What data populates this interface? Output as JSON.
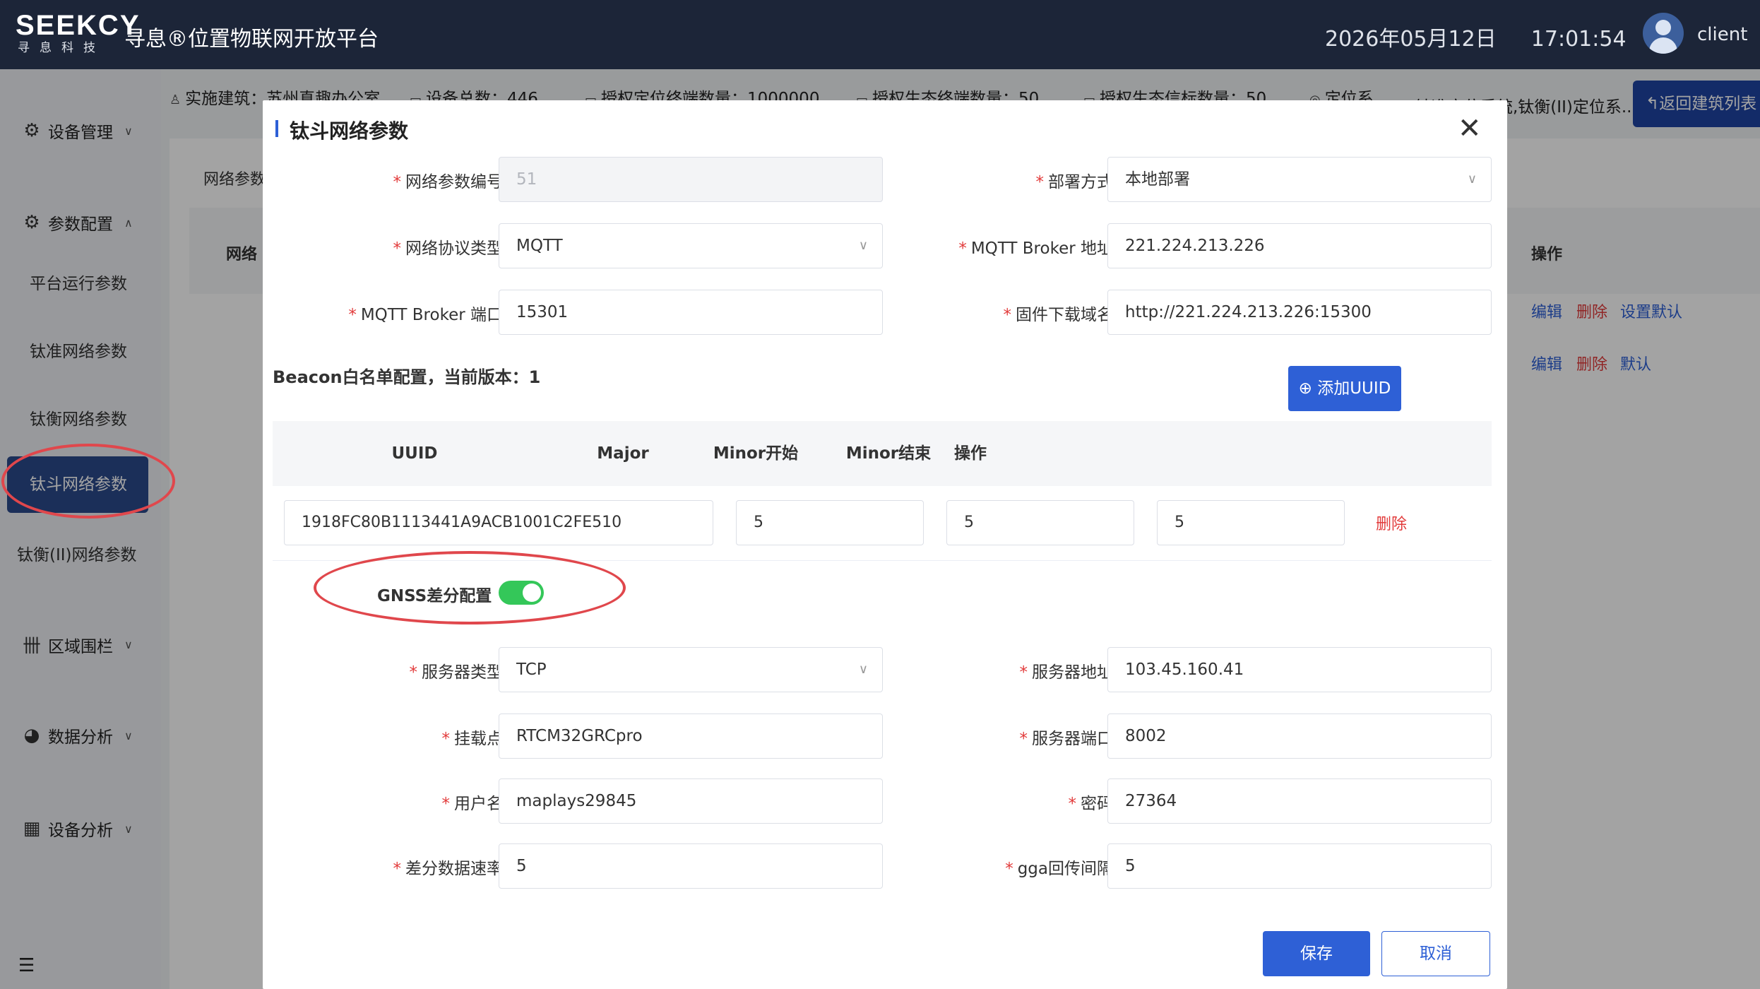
{
  "header": {
    "logo_main": "SEEKCY",
    "logo_sub": "寻息科技",
    "app_title": "寻息®位置物联网开放平台",
    "date": "2026年05月12日",
    "time": "17:01:54",
    "username": "client"
  },
  "sidebar": {
    "device_mgmt": "设备管理",
    "param_config": "参数配置",
    "items": [
      "平台运行参数",
      "钛准网络参数",
      "钛衡网络参数",
      "钛斗网络参数",
      "钛衡(II)网络参数"
    ],
    "area_fence": "区域围栏",
    "data_analysis": "数据分析",
    "device_analysis": "设备分析"
  },
  "infobar": {
    "building": "实施建筑：苏州真趣办公室",
    "device_total": "设备总数：446",
    "auth_terminal": "授权定位终端数量：1000000",
    "auth_eco_terminal": "授权生态终端数量：50",
    "auth_eco_beacon": "授权生态信标数量：50",
    "positioning": "定位系",
    "positioning_more": "钛准定位系统,钛衡(II)定位系...",
    "back_button": "返回建筑列表"
  },
  "background": {
    "filter_label": "网络参数",
    "col_network": "网络",
    "col_ops": "操作",
    "row1": {
      "edit": "编辑",
      "delete": "删除",
      "set_default": "设置默认"
    },
    "row2": {
      "edit": "编辑",
      "delete": "删除",
      "default": "默认"
    }
  },
  "modal": {
    "title": "钛斗网络参数",
    "fields": {
      "param_id": {
        "label": "网络参数编号",
        "value": "51"
      },
      "deploy": {
        "label": "部署方式",
        "value": "本地部署"
      },
      "protocol": {
        "label": "网络协议类型",
        "value": "MQTT"
      },
      "broker_addr": {
        "label": "MQTT Broker 地址",
        "value": "221.224.213.226"
      },
      "broker_port": {
        "label": "MQTT Broker 端口",
        "value": "15301"
      },
      "firmware_domain": {
        "label": "固件下载域名",
        "value": "http://221.224.213.226:15300"
      }
    },
    "beacon": {
      "title": "Beacon白名单配置，当前版本：1",
      "add_button": "添加UUID",
      "columns": [
        "UUID",
        "Major",
        "Minor开始",
        "Minor结束",
        "操作"
      ],
      "rows": [
        {
          "uuid": "1918FC80B1113441A9ACB1001C2FE510",
          "major": "5",
          "minor_start": "5",
          "minor_end": "5",
          "action": "删除"
        }
      ]
    },
    "gnss": {
      "label": "GNSS差分配置",
      "enabled": true,
      "server_type": {
        "label": "服务器类型",
        "value": "TCP"
      },
      "server_addr": {
        "label": "服务器地址",
        "value": "103.45.160.41"
      },
      "mount_point": {
        "label": "挂载点",
        "value": "RTCM32GRCpro"
      },
      "server_port": {
        "label": "服务器端口",
        "value": "8002"
      },
      "username": {
        "label": "用户名",
        "value": "maplays29845"
      },
      "password": {
        "label": "密码",
        "value": "27364"
      },
      "diff_rate": {
        "label": "差分数据速率",
        "value": "5"
      },
      "gga_interval": {
        "label": "gga回传间隔",
        "value": "5"
      }
    },
    "save": "保存",
    "cancel": "取消"
  },
  "colors": {
    "header_bg": "#1c2538",
    "primary": "#2e60d6",
    "danger": "#e23a3a",
    "switch_on": "#34c759",
    "annotation": "#e0474c",
    "sidebar_active": "#2b4a8c"
  }
}
